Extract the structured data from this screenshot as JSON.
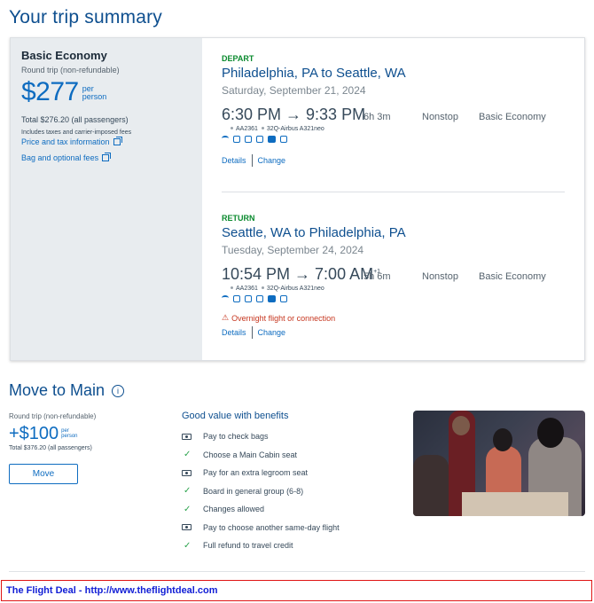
{
  "page_title": "Your trip summary",
  "fare": {
    "name": "Basic Economy",
    "subtitle": "Round trip (non-refundable)",
    "price": "$277",
    "per_label_1": "per",
    "per_label_2": "person",
    "total": "Total $276.20 (all passengers)",
    "includes": "Includes taxes and carrier-imposed fees",
    "price_tax_link": "Price and tax information",
    "bag_link": "Bag and optional fees"
  },
  "depart": {
    "label": "DEPART",
    "route": "Philadelphia, PA to Seattle, WA",
    "date": "Saturday, September 21, 2024",
    "times": "6:30 PM  →  9:33 PM",
    "duration": "6h 3m",
    "stops": "Nonstop",
    "cabin": "Basic Economy",
    "flight_number": "AA2361",
    "aircraft": "32Q-Airbus A321neo",
    "details_link": "Details",
    "change_link": "Change"
  },
  "return": {
    "label": "RETURN",
    "route": "Seattle, WA to Philadelphia, PA",
    "date": "Tuesday, September 24, 2024",
    "times": "10:54 PM  →  7:00 AM",
    "next_day": "+1",
    "duration": "5h 6m",
    "stops": "Nonstop",
    "cabin": "Basic Economy",
    "flight_number": "AA2361",
    "aircraft": "32Q-Airbus A321neo",
    "warning": "Overnight flight or connection",
    "details_link": "Details",
    "change_link": "Change"
  },
  "move": {
    "title": "Move to Main",
    "subtitle": "Round trip (non-refundable)",
    "price": "+$100",
    "per_label_1": "per",
    "per_label_2": "person",
    "total": "Total $376.20 (all passengers)",
    "button": "Move",
    "benefits_title": "Good value with benefits",
    "benefits": [
      {
        "icon": "pay-icon",
        "text": "Pay to check bags"
      },
      {
        "icon": "check-icon",
        "text": "Choose a Main Cabin seat"
      },
      {
        "icon": "pay-icon",
        "text": "Pay for an extra legroom seat"
      },
      {
        "icon": "check-icon",
        "text": "Board in general group (6-8)"
      },
      {
        "icon": "check-icon",
        "text": "Changes allowed"
      },
      {
        "icon": "pay-icon",
        "text": "Pay to choose another same-day flight"
      },
      {
        "icon": "check-icon",
        "text": "Full refund to travel credit"
      }
    ]
  },
  "footer": {
    "deal_text": "The Flight Deal - http://www.theflightdeal.com"
  },
  "colors": {
    "brand_blue": "#0e6cc0",
    "title_blue": "#0e4f8f",
    "depart_green": "#0a8a2e",
    "warning_red": "#c6361f",
    "deal_border": "#e01515",
    "deal_text": "#1320d6"
  }
}
